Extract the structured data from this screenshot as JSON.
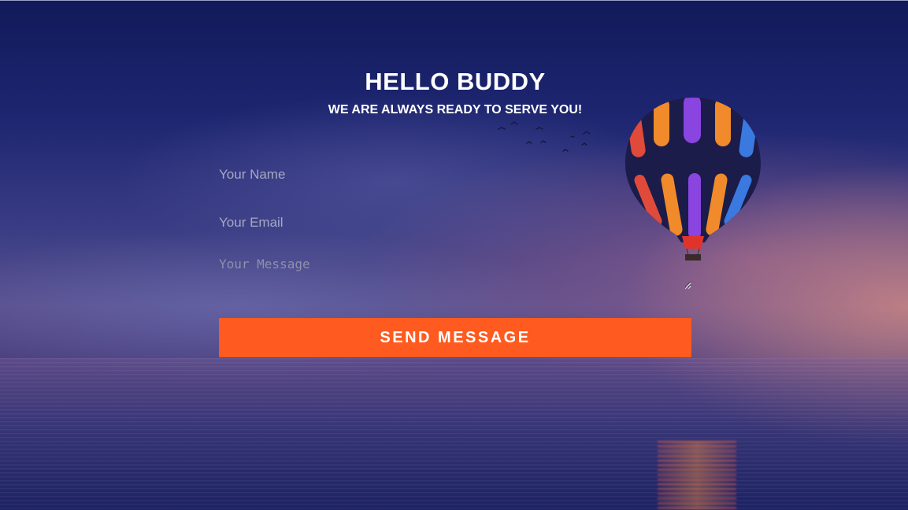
{
  "header": {
    "title": "HELLO BUDDY",
    "subtitle": "WE ARE ALWAYS READY TO SERVE YOU!"
  },
  "form": {
    "name_placeholder": "Your Name",
    "email_placeholder": "Your Email",
    "message_placeholder": "Your Message",
    "submit_label": "SEND MESSAGE"
  },
  "colors": {
    "accent": "#ff5a1f",
    "text": "#ffffff",
    "placeholder": "#a6a8c2"
  },
  "background": {
    "icons": [
      "hot-air-balloon-icon",
      "birds-icon"
    ]
  }
}
